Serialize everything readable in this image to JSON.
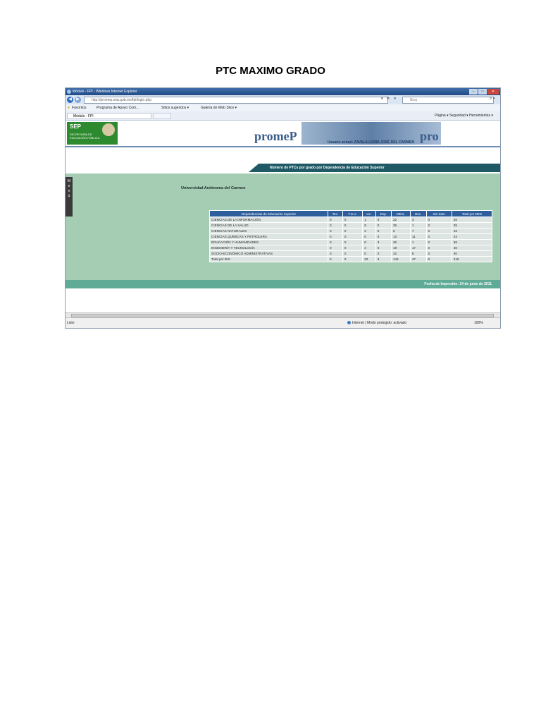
{
  "document": {
    "title": "PTC MAXIMO GRADO"
  },
  "browser": {
    "window_title": "Módulo - FPI - Windows Internet Explorer",
    "url": "http://promep.sep.gob.mx/fpi/login.php",
    "search_placeholder": "Bing",
    "favorites": {
      "favorites_label": "Favoritos",
      "program_label": "Programa de Apoyo Com...",
      "suggested_label": "Sitios sugeridos ▾",
      "gallery_label": "Galería de Web Slice ▾"
    },
    "tab_label": "Módulo - FPI",
    "commands": "Página ▾  Seguridad ▾  Herramientas ▾",
    "status": {
      "left": "Listo",
      "zone": "Internet | Modo protegido: activado",
      "zoom": "100%"
    }
  },
  "page": {
    "sep_logo": "SEP",
    "sep_subtitle": "SECRETARÍA DE EDUCACIÓN PÚBLICA",
    "promep_logo": "promeP",
    "promep_logo_tail": "pro",
    "user_line": "Usuario actual: ZAVALA LORIA JOSÉ DEL CARMEN",
    "section_title": "Número de PTCs por grado por Dependencia de Educación Superior",
    "menu_label": "Menú",
    "university": "Universidad Autónoma del Carmen",
    "table": {
      "headers": [
        "Dependencias de Educación Superior",
        "Tec.",
        "T.S.U.",
        "Lic.",
        "Esp.",
        "Mtría.",
        "Doc.",
        "Sin dato",
        "Total por DES"
      ],
      "rows": [
        [
          "CIENCIAS DE LA INFORMACIÓN",
          "0",
          "0",
          "1",
          "0",
          "22",
          "3",
          "0",
          "26"
        ],
        [
          "CIENCIAS DE LA SALUD",
          "0",
          "0",
          "9",
          "0",
          "25",
          "1",
          "0",
          "35"
        ],
        [
          "CIENCIAS NATURALES",
          "0",
          "0",
          "2",
          "0",
          "6",
          "7",
          "0",
          "15"
        ],
        [
          "CIENCIAS QUÍMICAS Y PETROLERA",
          "0",
          "0",
          "0",
          "0",
          "13",
          "11",
          "0",
          "24"
        ],
        [
          "EDUCACIÓN Y HUMANIDADES",
          "0",
          "0",
          "6",
          "3",
          "26",
          "1",
          "0",
          "36"
        ],
        [
          "INGENIERÍA Y TECNOLOGÍA",
          "0",
          "0",
          "4",
          "0",
          "19",
          "17",
          "0",
          "40"
        ],
        [
          "SOCIO-ECONÓMICO ADMINISTRATIVAS",
          "0",
          "0",
          "0",
          "0",
          "32",
          "8",
          "0",
          "40"
        ],
        [
          "Total por IES:",
          "0",
          "0",
          "22",
          "3",
          "144",
          "47",
          "0",
          "216"
        ]
      ]
    },
    "footer": "Fecha de Impresión: 14 de junio de 2011"
  }
}
